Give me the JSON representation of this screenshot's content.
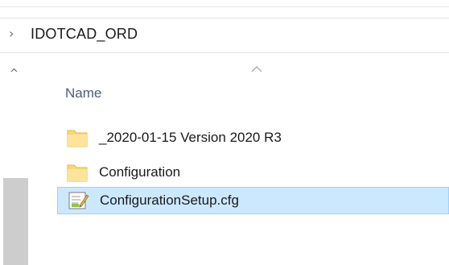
{
  "breadcrumb": {
    "separator_icon": "chevron-right-icon",
    "current_folder": "IDOTCAD_ORD"
  },
  "file_list": {
    "column_header": "Name",
    "sort_indicator_icon": "sort-ascending-icon",
    "items": [
      {
        "name": "_2020-01-15 Version 2020 R3",
        "type": "folder",
        "icon": "folder-icon",
        "selected": false
      },
      {
        "name": "Configuration",
        "type": "folder",
        "icon": "folder-icon",
        "selected": false
      },
      {
        "name": "ConfigurationSetup.cfg",
        "type": "file",
        "icon": "cfg-file-icon",
        "selected": true
      }
    ]
  },
  "navigation_pane": {
    "scroll_up_icon": "scroll-up-arrow-icon"
  },
  "colors": {
    "selection_fill": "#cce8ff",
    "selection_border": "#99d1ff",
    "folder_yellow": "#f8d775",
    "header_text": "#4c607a"
  }
}
